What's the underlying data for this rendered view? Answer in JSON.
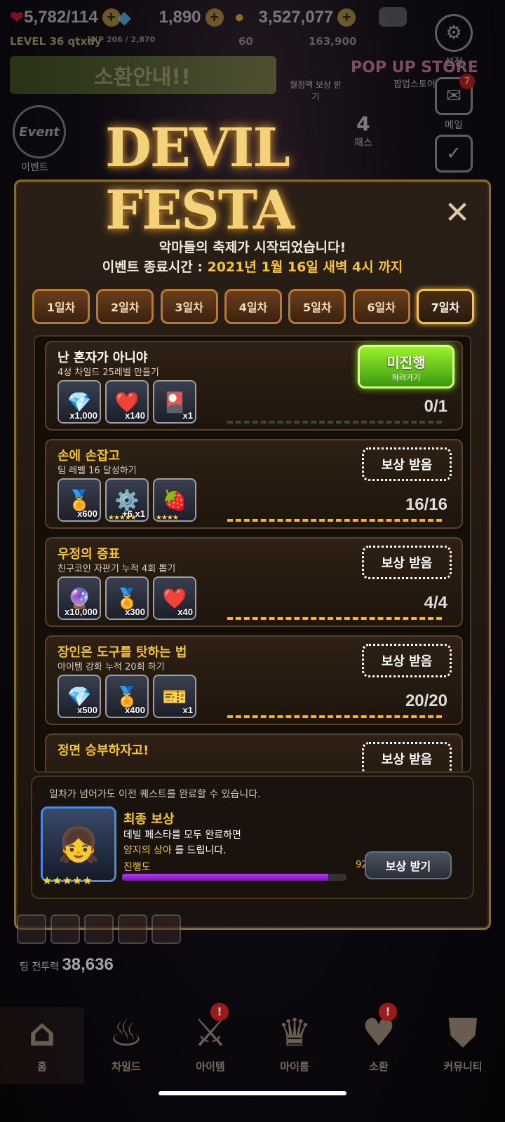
{
  "hud": {
    "hearts": "5,782/114",
    "gems": "1,890",
    "gold": "3,527,077",
    "level_label": "LEVEL 36 qtxdy",
    "exp": "EXP 206 / 2,870",
    "res4": "60",
    "res5": "163,900"
  },
  "side": {
    "settings": "설정",
    "mail": "메일",
    "mail_badge": "7",
    "pass": "패스",
    "pass_level": "4",
    "popup_store": "팝업스토어",
    "reward_receive": "월정액 보상 받기",
    "event": "이벤트",
    "event_badge": "Event"
  },
  "banner": "소환안내!!",
  "header": {
    "logo": "DEVIL FESTA",
    "subtitle": "악마들의 축제가 시작되었습니다!",
    "end_prefix": "이벤트 종료시간 :",
    "end_time": "2021년 1월 16일 새벽 4시 까지"
  },
  "tabs": [
    "1일차",
    "2일차",
    "3일차",
    "4일차",
    "5일차",
    "6일차",
    "7일차"
  ],
  "quests": [
    {
      "title": "난 혼자가 아니야",
      "desc": "4성 차일드 25레벨 만들기",
      "items": [
        {
          "icon": "💎",
          "count": "x1,000"
        },
        {
          "icon": "❤️",
          "count": "x140"
        },
        {
          "icon": "🎴",
          "count": "x1"
        }
      ],
      "progress": "0/1",
      "button": "미진행",
      "button_sub": "하러가기"
    },
    {
      "title": "손에 손잡고",
      "desc": "팀 레벨 16 달성하기",
      "items": [
        {
          "icon": "🏅",
          "count": "x600"
        },
        {
          "icon": "⚙️",
          "count": "+6 x1"
        },
        {
          "icon": "🍓",
          "count": ""
        }
      ],
      "progress": "16/16",
      "button": "보상 받음"
    },
    {
      "title": "우정의 증표",
      "desc": "친구코인 자판기 누적 4회 뽑기",
      "items": [
        {
          "icon": "🔮",
          "count": "x10,000"
        },
        {
          "icon": "🏅",
          "count": "x300"
        },
        {
          "icon": "❤️",
          "count": "x40"
        }
      ],
      "progress": "4/4",
      "button": "보상 받음"
    },
    {
      "title": "장인은 도구를 탓하는 법",
      "desc": "아이템 강화 누적 20회 하기",
      "items": [
        {
          "icon": "💎",
          "count": "x500"
        },
        {
          "icon": "🏅",
          "count": "x400"
        },
        {
          "icon": "🎫",
          "count": "x1"
        }
      ],
      "progress": "20/20",
      "button": "보상 받음"
    },
    {
      "title": "정면 승부하자고!",
      "button": "보상 받음"
    }
  ],
  "final": {
    "note": "일차가 넘어가도 이전 퀘스트를 완료할 수 있습니다.",
    "title": "최종 보상",
    "desc1": "데빌 페스타를 모두 완료하면",
    "desc2_hl": "양지의 상아",
    "desc2_rest": "를 드립니다.",
    "progress_label": "진행도",
    "progress_pct": "92%",
    "progress_value": 0.92,
    "button": "보상 받기"
  },
  "team_power_label": "팀 전투력",
  "team_power": "38,636",
  "nav": [
    "홈",
    "차일드",
    "아이템",
    "마이룸",
    "소환",
    "커뮤니티"
  ],
  "colors": {
    "accent": "#f7c531",
    "green": "#7adf20",
    "purple": "#9a28e0"
  }
}
